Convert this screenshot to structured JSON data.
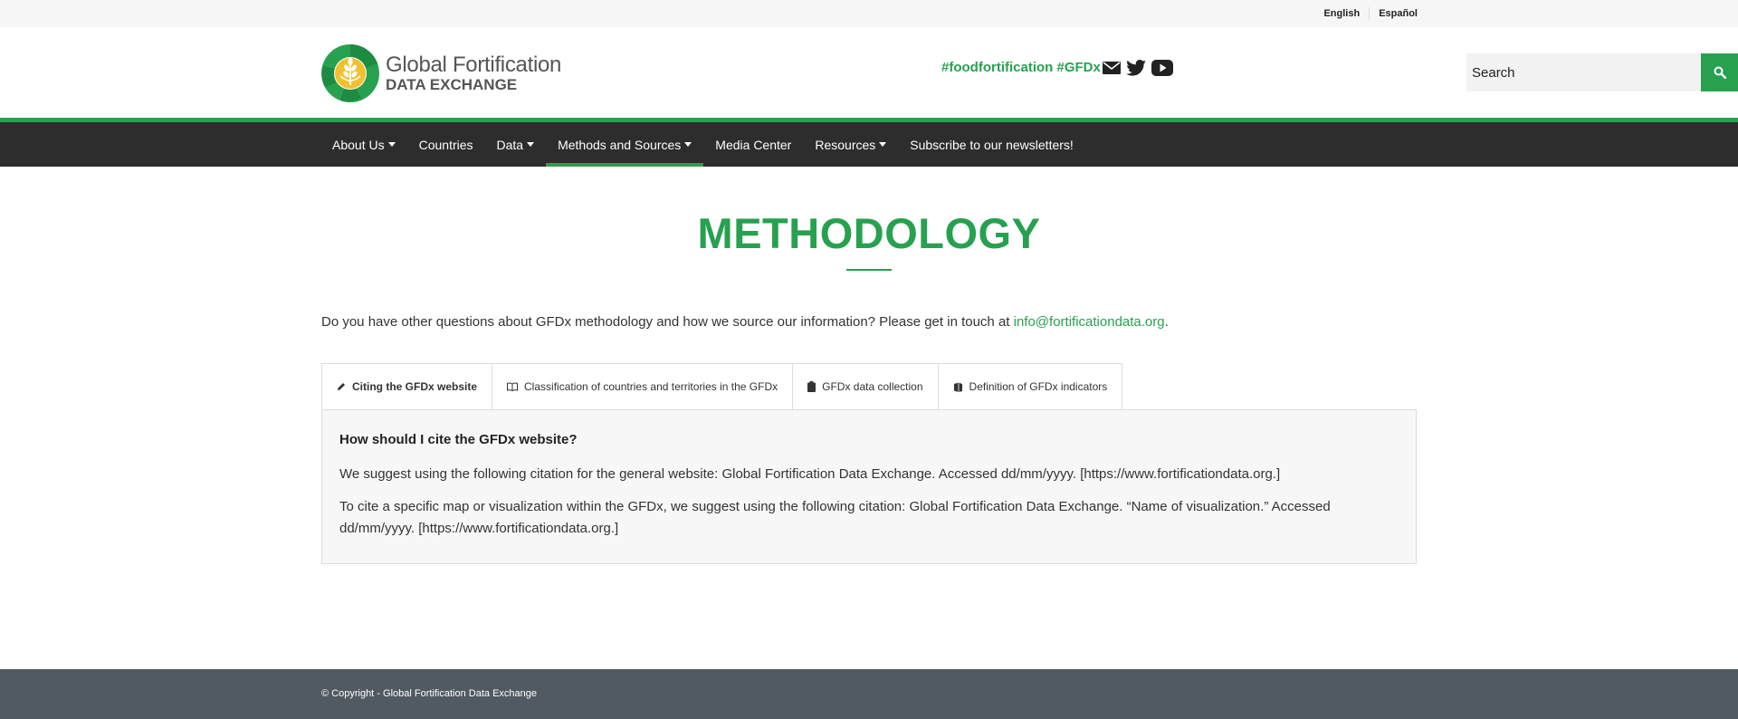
{
  "top_bar": {
    "languages": [
      "English",
      "Español"
    ]
  },
  "header": {
    "logo_line1": "Global Fortification",
    "logo_line2": "DATA EXCHANGE",
    "hashtags": "#foodfortification #GFDx",
    "social_icons": [
      "email-icon",
      "twitter-icon",
      "youtube-icon"
    ],
    "search_placeholder": "Search"
  },
  "nav": {
    "items": [
      {
        "label": "About Us",
        "dropdown": true
      },
      {
        "label": "Countries",
        "dropdown": false
      },
      {
        "label": "Data",
        "dropdown": true
      },
      {
        "label": "Methods and Sources",
        "dropdown": true,
        "active": true
      },
      {
        "label": "Media Center",
        "dropdown": false
      },
      {
        "label": "Resources",
        "dropdown": true
      },
      {
        "label": "Subscribe to our newsletters!",
        "dropdown": false
      }
    ]
  },
  "main": {
    "title": "METHODOLOGY",
    "intro_text": "Do you have other questions about GFDx methodology and how we source our information? Please get in touch at ",
    "intro_email": "info@fortificationdata.org",
    "intro_end": ".",
    "tabs": [
      {
        "label": "Citing the GFDx website",
        "icon": "pencil-icon",
        "active": true
      },
      {
        "label": "Classification of countries and territories in the GFDx",
        "icon": "book-icon"
      },
      {
        "label": "GFDx data collection",
        "icon": "clipboard-icon"
      },
      {
        "label": "Definition of GFDx indicators",
        "icon": "books-icon"
      }
    ],
    "panel": {
      "question": "How should I cite the GFDx website?",
      "paragraph1": "We suggest using the following citation for the general website: Global Fortification Data Exchange. Accessed dd/mm/yyyy. [https://www.fortificationdata.org.]",
      "paragraph2": "To cite a specific map or visualization within the GFDx, we suggest using the following citation: Global Fortification Data Exchange. “Name of visualization.” Accessed dd/mm/yyyy. [https://www.fortificationdata.org.]"
    }
  },
  "footer": {
    "copyright": "© Copyright - Global Fortification Data Exchange"
  },
  "colors": {
    "brand_green": "#27a14f",
    "nav_bg": "#2d2d2d",
    "footer_bg": "#525a61",
    "logo_yellow": "#f2c12e"
  }
}
